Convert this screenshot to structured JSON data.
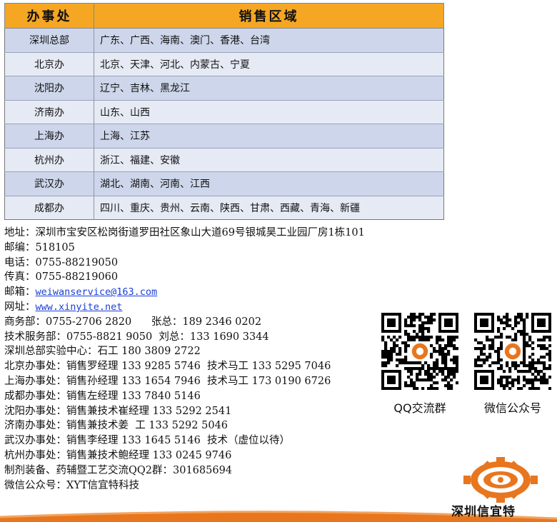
{
  "table": {
    "header": {
      "office": "办事处",
      "region": "销售区域"
    },
    "rows": [
      {
        "office": "深圳总部",
        "region": "广东、广西、海南、澳门、香港、台湾"
      },
      {
        "office": "北京办",
        "region": "北京、天津、河北、内蒙古、宁夏"
      },
      {
        "office": "沈阳办",
        "region": "辽宁、吉林、黑龙江"
      },
      {
        "office": "济南办",
        "region": "山东、山西"
      },
      {
        "office": "上海办",
        "region": "上海、江苏"
      },
      {
        "office": "杭州办",
        "region": "浙江、福建、安徽"
      },
      {
        "office": "武汉办",
        "region": "湖北、湖南、河南、江西"
      },
      {
        "office": "成都办",
        "region": "四川、重庆、贵州、云南、陕西、甘肃、西藏、青海、新疆"
      }
    ]
  },
  "contact": {
    "address": "地址：深圳市宝安区松岗街道罗田社区象山大道69号银城昊工业园厂房1栋101",
    "postcode_label": "邮编：",
    "postcode": "518105",
    "phone_label": "电话：",
    "phone": "0755-88219050",
    "fax_label": "传真：",
    "fax": "0755-88219060",
    "email_label": "邮箱：",
    "email": "weiwanservice@163.com",
    "web_label": "网址：",
    "web": "www.xinyite.net",
    "lines": [
      "商务部：0755-2706 2820      张总：189 2346 0202",
      "技术服务部：0755-8821 9050  刘总：133 1690 3344",
      "深圳总部实验中心：石工 180 3809 2722",
      "北京办事处：销售罗经理 133 9285 5746  技术马工 133 5295 7046",
      "上海办事处：销售孙经理 133 1654 7946  技术马工 173 0190 6726",
      "成都办事处：销售左经理 133 7840 5146",
      "沈阳办事处：销售兼技术崔经理 133 5292 2541",
      "济南办事处：销售兼技术姜  工 133 5292 5046",
      "武汉办事处：销售李经理 133 1645 5146  技术（虚位以待）",
      "杭州办事处：销售兼技术鲍经理 133 0245 9746",
      "制剂装备、药辅暨工艺交流QQ2群：301685694",
      "微信公众号：XYT信宜特科技"
    ]
  },
  "qr": {
    "qq_label": "QQ交流群",
    "wechat_label": "微信公众号"
  },
  "logo": {
    "text": "深圳信宜特"
  },
  "colors": {
    "header": "#f5a623",
    "row_odd": "#cdd6ea",
    "row_even": "#e6eaf4",
    "brand": "#e8761e",
    "link": "#1a3fd6"
  }
}
